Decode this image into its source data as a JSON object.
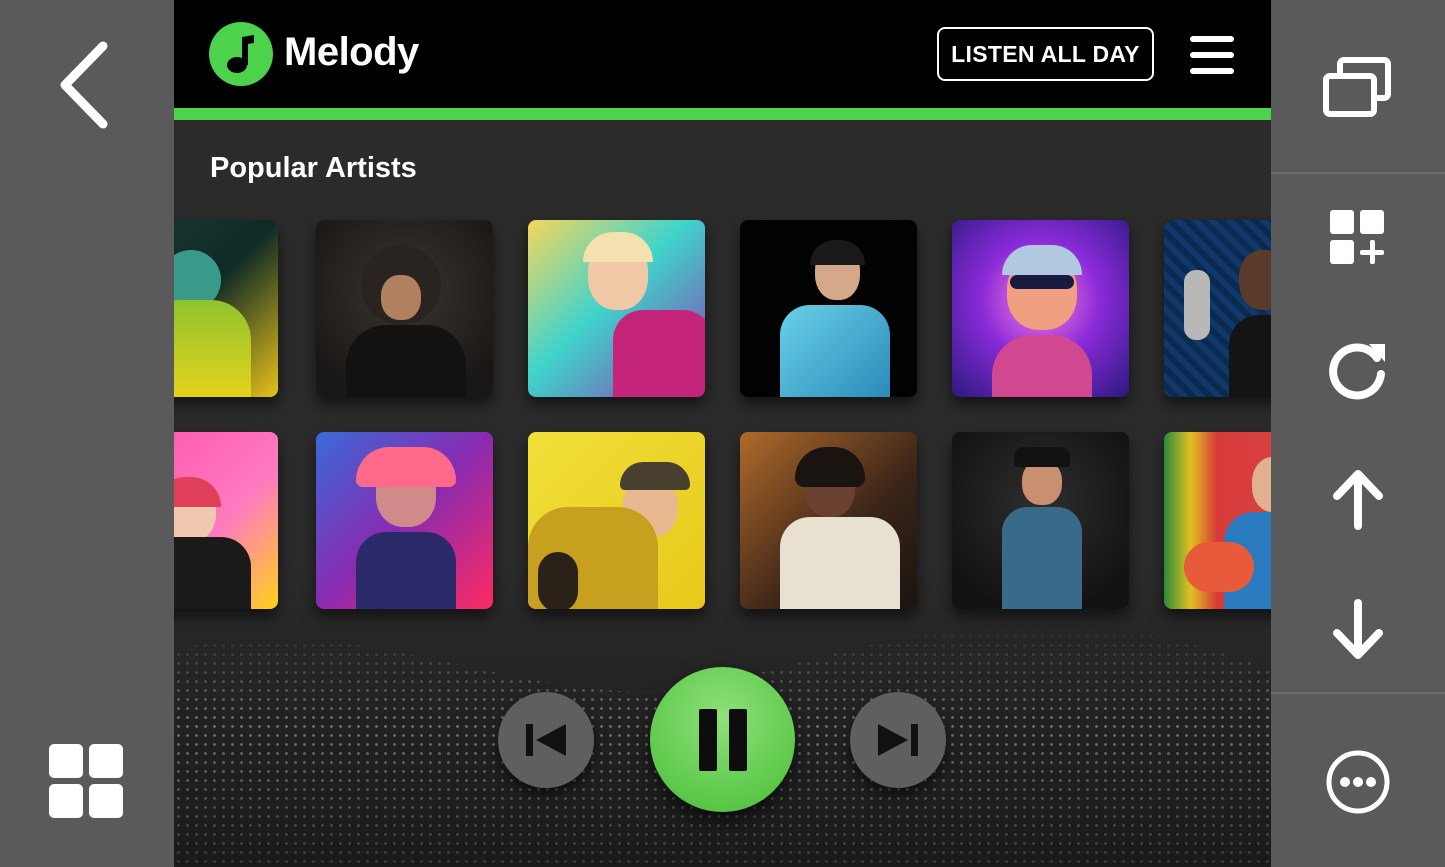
{
  "app": {
    "name": "Melody",
    "header_button": "LISTEN ALL DAY",
    "section_title": "Popular Artists"
  },
  "colors": {
    "accent": "#4cd24c",
    "header_bg": "#000000",
    "content_bg": "#2b2b2b",
    "rail_bg": "#5a5a5a"
  },
  "left_rail": {
    "top_icon": "chevron-left-icon",
    "bottom_icon": "grid-icon"
  },
  "right_rail": {
    "icons": [
      "windows-icon",
      "add-widget-icon",
      "refresh-icon",
      "arrow-up-icon",
      "arrow-down-icon",
      "more-icon"
    ]
  },
  "artists": {
    "row1": [
      "artist-1",
      "artist-2",
      "artist-3",
      "artist-4",
      "artist-5",
      "artist-6"
    ],
    "row2": [
      "artist-7",
      "artist-8",
      "artist-9",
      "artist-10",
      "artist-11",
      "artist-12"
    ]
  },
  "player": {
    "state": "playing",
    "icons": [
      "previous-icon",
      "pause-icon",
      "next-icon"
    ]
  }
}
